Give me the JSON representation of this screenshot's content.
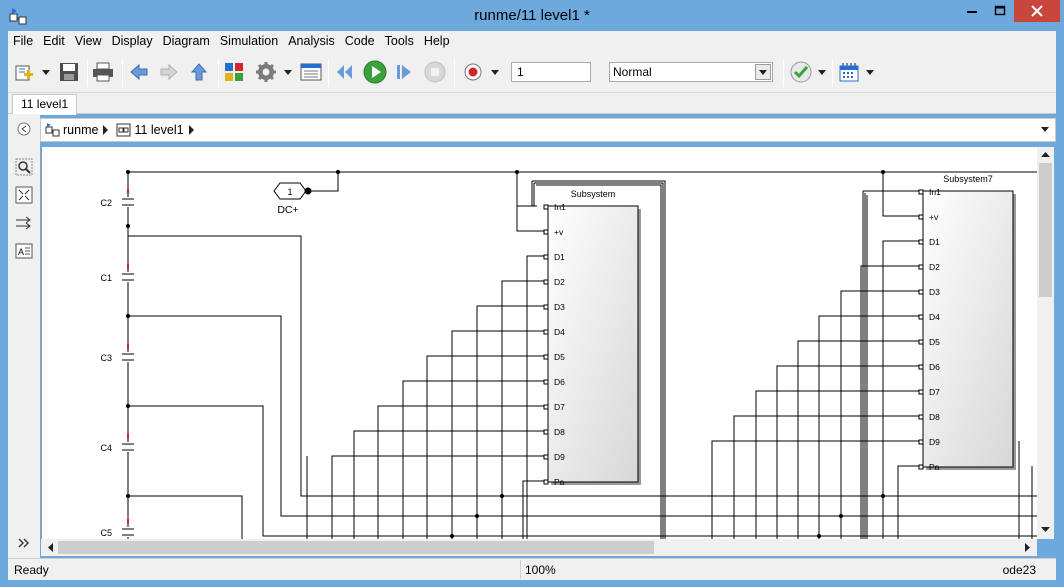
{
  "window": {
    "title": "runme/11 level1 *"
  },
  "menu": [
    "File",
    "Edit",
    "View",
    "Display",
    "Diagram",
    "Simulation",
    "Analysis",
    "Code",
    "Tools",
    "Help"
  ],
  "toolbar": {
    "stop_time": "1",
    "sim_mode": "Normal"
  },
  "tabs": [
    {
      "label": "11 level1"
    }
  ],
  "breadcrumb": [
    {
      "label": "runme"
    },
    {
      "label": "11 level1"
    }
  ],
  "diagram": {
    "capacitors": [
      "C2",
      "C1",
      "C3",
      "C4",
      "C5"
    ],
    "inport": {
      "number": "1",
      "label": "DC+"
    },
    "subsystems": [
      {
        "title": "Subsystem",
        "ports": [
          "In1",
          "+v",
          "D1",
          "D2",
          "D3",
          "D4",
          "D5",
          "D6",
          "D7",
          "D8",
          "D9",
          "Pa"
        ]
      },
      {
        "title": "Subsystem7",
        "ports": [
          "In1",
          "+v",
          "D1",
          "D2",
          "D3",
          "D4",
          "D5",
          "D6",
          "D7",
          "D8",
          "D9",
          "Pa"
        ]
      }
    ]
  },
  "status": {
    "state": "Ready",
    "zoom": "100%",
    "solver": "ode23"
  },
  "colors": {
    "titlebar": "#6ea9de",
    "close_button": "#c9463d",
    "run_green": "#3aa23a",
    "record_red": "#d0282e"
  }
}
